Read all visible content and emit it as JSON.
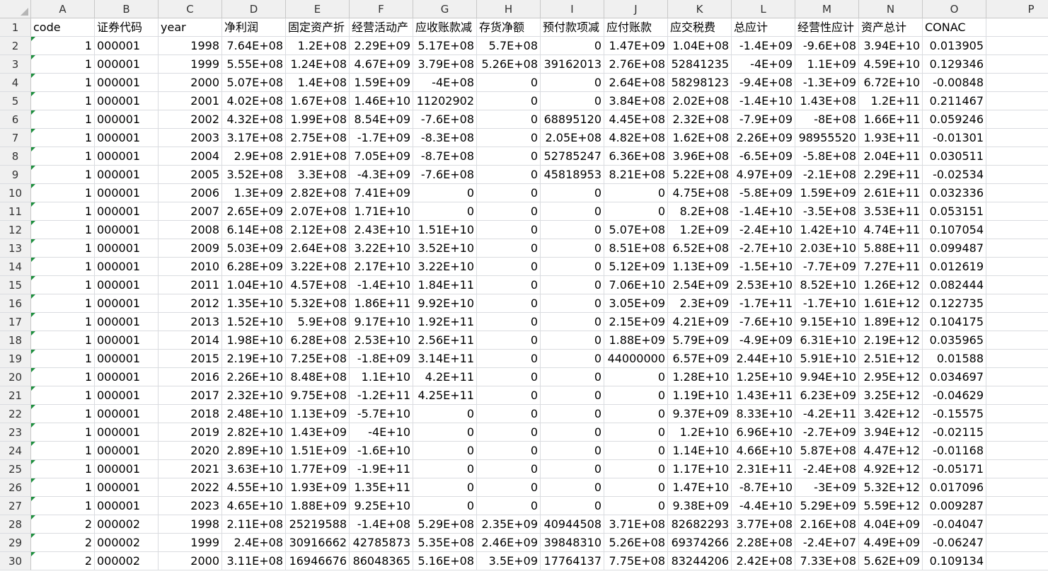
{
  "columns": [
    "A",
    "B",
    "C",
    "D",
    "E",
    "F",
    "G",
    "H",
    "I",
    "J",
    "K",
    "L",
    "M",
    "N",
    "O",
    "P"
  ],
  "header_row": {
    "num": "1",
    "cells": [
      "code",
      "证券代码",
      "year",
      "净利润",
      "固定资产折",
      "经营活动产",
      "应收账款减",
      "存货净额",
      "预付款项减",
      "应付账款",
      "应交税费",
      "总应计",
      "经营性应计",
      "资产总计",
      "CONAC",
      ""
    ]
  },
  "rows": [
    {
      "num": "2",
      "cells": [
        "1",
        "000001",
        "1998",
        "7.64E+08",
        "1.2E+08",
        "2.29E+09",
        "5.17E+08",
        "5.7E+08",
        "0",
        "1.47E+09",
        "1.04E+08",
        "-1.4E+09",
        "-9.6E+08",
        "3.94E+10",
        "0.013905"
      ]
    },
    {
      "num": "3",
      "cells": [
        "1",
        "000001",
        "1999",
        "5.55E+08",
        "1.24E+08",
        "4.67E+09",
        "3.79E+08",
        "5.26E+08",
        "39162013",
        "2.76E+08",
        "52841235",
        "-4E+09",
        "1.1E+09",
        "4.59E+10",
        "0.129346"
      ]
    },
    {
      "num": "4",
      "cells": [
        "1",
        "000001",
        "2000",
        "5.07E+08",
        "1.4E+08",
        "1.59E+09",
        "-4E+08",
        "0",
        "0",
        "2.64E+08",
        "58298123",
        "-9.4E+08",
        "-1.3E+09",
        "6.72E+10",
        "-0.00848"
      ]
    },
    {
      "num": "5",
      "cells": [
        "1",
        "000001",
        "2001",
        "4.02E+08",
        "1.67E+08",
        "1.46E+10",
        "11202902",
        "0",
        "0",
        "3.84E+08",
        "2.02E+08",
        "-1.4E+10",
        "1.43E+08",
        "1.2E+11",
        "0.211467"
      ]
    },
    {
      "num": "6",
      "cells": [
        "1",
        "000001",
        "2002",
        "4.32E+08",
        "1.99E+08",
        "8.54E+09",
        "-7.6E+08",
        "0",
        "68895120",
        "4.45E+08",
        "2.32E+08",
        "-7.9E+09",
        "-8E+08",
        "1.66E+11",
        "0.059246"
      ]
    },
    {
      "num": "7",
      "cells": [
        "1",
        "000001",
        "2003",
        "3.17E+08",
        "2.75E+08",
        "-1.7E+09",
        "-8.3E+08",
        "0",
        "2.05E+08",
        "4.82E+08",
        "1.62E+08",
        "2.26E+09",
        "98955520",
        "1.93E+11",
        "-0.01301"
      ]
    },
    {
      "num": "8",
      "cells": [
        "1",
        "000001",
        "2004",
        "2.9E+08",
        "2.91E+08",
        "7.05E+09",
        "-8.7E+08",
        "0",
        "52785247",
        "6.36E+08",
        "3.96E+08",
        "-6.5E+09",
        "-5.8E+08",
        "2.04E+11",
        "0.030511"
      ]
    },
    {
      "num": "9",
      "cells": [
        "1",
        "000001",
        "2005",
        "3.52E+08",
        "3.3E+08",
        "-4.3E+09",
        "-7.6E+08",
        "0",
        "45818953",
        "8.21E+08",
        "5.22E+08",
        "4.97E+09",
        "-2.1E+08",
        "2.29E+11",
        "-0.02534"
      ]
    },
    {
      "num": "10",
      "cells": [
        "1",
        "000001",
        "2006",
        "1.3E+09",
        "2.82E+08",
        "7.41E+09",
        "0",
        "0",
        "0",
        "0",
        "4.75E+08",
        "-5.8E+09",
        "1.59E+09",
        "2.61E+11",
        "0.032336"
      ]
    },
    {
      "num": "11",
      "cells": [
        "1",
        "000001",
        "2007",
        "2.65E+09",
        "2.07E+08",
        "1.71E+10",
        "0",
        "0",
        "0",
        "0",
        "8.2E+08",
        "-1.4E+10",
        "-3.5E+08",
        "3.53E+11",
        "0.053151"
      ]
    },
    {
      "num": "12",
      "cells": [
        "1",
        "000001",
        "2008",
        "6.14E+08",
        "2.12E+08",
        "2.43E+10",
        "1.51E+10",
        "0",
        "0",
        "5.07E+08",
        "1.2E+09",
        "-2.4E+10",
        "1.42E+10",
        "4.74E+11",
        "0.107054"
      ]
    },
    {
      "num": "13",
      "cells": [
        "1",
        "000001",
        "2009",
        "5.03E+09",
        "2.64E+08",
        "3.22E+10",
        "3.52E+10",
        "0",
        "0",
        "8.51E+08",
        "6.52E+08",
        "-2.7E+10",
        "2.03E+10",
        "5.88E+11",
        "0.099487"
      ]
    },
    {
      "num": "14",
      "cells": [
        "1",
        "000001",
        "2010",
        "6.28E+09",
        "3.22E+08",
        "2.17E+10",
        "3.22E+10",
        "0",
        "0",
        "5.12E+09",
        "1.13E+09",
        "-1.5E+10",
        "-7.7E+09",
        "7.27E+11",
        "0.012619"
      ]
    },
    {
      "num": "15",
      "cells": [
        "1",
        "000001",
        "2011",
        "1.04E+10",
        "4.57E+08",
        "-1.4E+10",
        "1.84E+11",
        "0",
        "0",
        "7.06E+10",
        "2.54E+09",
        "2.53E+10",
        "8.52E+10",
        "1.26E+12",
        "0.082444"
      ]
    },
    {
      "num": "16",
      "cells": [
        "1",
        "000001",
        "2012",
        "1.35E+10",
        "5.32E+08",
        "1.86E+11",
        "9.92E+10",
        "0",
        "0",
        "3.05E+09",
        "2.3E+09",
        "-1.7E+11",
        "-1.7E+10",
        "1.61E+12",
        "0.122735"
      ]
    },
    {
      "num": "17",
      "cells": [
        "1",
        "000001",
        "2013",
        "1.52E+10",
        "5.9E+08",
        "9.17E+10",
        "1.92E+11",
        "0",
        "0",
        "2.15E+09",
        "4.21E+09",
        "-7.6E+10",
        "9.15E+10",
        "1.89E+12",
        "0.104175"
      ]
    },
    {
      "num": "18",
      "cells": [
        "1",
        "000001",
        "2014",
        "1.98E+10",
        "6.28E+08",
        "2.53E+10",
        "2.56E+11",
        "0",
        "0",
        "1.88E+09",
        "5.79E+09",
        "-4.9E+09",
        "6.31E+10",
        "2.19E+12",
        "0.035965"
      ]
    },
    {
      "num": "19",
      "cells": [
        "1",
        "000001",
        "2015",
        "2.19E+10",
        "7.25E+08",
        "-1.8E+09",
        "3.14E+11",
        "0",
        "0",
        "44000000",
        "6.57E+09",
        "2.44E+10",
        "5.91E+10",
        "2.51E+12",
        "0.01588"
      ]
    },
    {
      "num": "20",
      "cells": [
        "1",
        "000001",
        "2016",
        "2.26E+10",
        "8.48E+08",
        "1.1E+10",
        "4.2E+11",
        "0",
        "0",
        "0",
        "1.28E+10",
        "1.25E+10",
        "9.94E+10",
        "2.95E+12",
        "0.034697"
      ]
    },
    {
      "num": "21",
      "cells": [
        "1",
        "000001",
        "2017",
        "2.32E+10",
        "9.75E+08",
        "-1.2E+11",
        "4.25E+11",
        "0",
        "0",
        "0",
        "1.19E+10",
        "1.43E+11",
        "6.23E+09",
        "3.25E+12",
        "-0.04629"
      ]
    },
    {
      "num": "22",
      "cells": [
        "1",
        "000001",
        "2018",
        "2.48E+10",
        "1.13E+09",
        "-5.7E+10",
        "0",
        "0",
        "0",
        "0",
        "9.37E+09",
        "8.33E+10",
        "-4.2E+11",
        "3.42E+12",
        "-0.15575"
      ]
    },
    {
      "num": "23",
      "cells": [
        "1",
        "000001",
        "2019",
        "2.82E+10",
        "1.43E+09",
        "-4E+10",
        "0",
        "0",
        "0",
        "0",
        "1.2E+10",
        "6.96E+10",
        "-2.7E+09",
        "3.94E+12",
        "-0.02115"
      ]
    },
    {
      "num": "24",
      "cells": [
        "1",
        "000001",
        "2020",
        "2.89E+10",
        "1.51E+09",
        "-1.6E+10",
        "0",
        "0",
        "0",
        "0",
        "1.14E+10",
        "4.66E+10",
        "5.87E+08",
        "4.47E+12",
        "-0.01168"
      ]
    },
    {
      "num": "25",
      "cells": [
        "1",
        "000001",
        "2021",
        "3.63E+10",
        "1.77E+09",
        "-1.9E+11",
        "0",
        "0",
        "0",
        "0",
        "1.17E+10",
        "2.31E+11",
        "-2.4E+08",
        "4.92E+12",
        "-0.05171"
      ]
    },
    {
      "num": "26",
      "cells": [
        "1",
        "000001",
        "2022",
        "4.55E+10",
        "1.93E+09",
        "1.35E+11",
        "0",
        "0",
        "0",
        "0",
        "1.47E+10",
        "-8.7E+10",
        "-3E+09",
        "5.32E+12",
        "0.017096"
      ]
    },
    {
      "num": "27",
      "cells": [
        "1",
        "000001",
        "2023",
        "4.65E+10",
        "1.88E+09",
        "9.25E+10",
        "0",
        "0",
        "0",
        "0",
        "9.38E+09",
        "-4.4E+10",
        "5.29E+09",
        "5.59E+12",
        "0.009287"
      ]
    },
    {
      "num": "28",
      "cells": [
        "2",
        "000002",
        "1998",
        "2.11E+08",
        "25219588",
        "-1.4E+08",
        "5.29E+08",
        "2.35E+09",
        "40944508",
        "3.71E+08",
        "82682293",
        "3.77E+08",
        "2.16E+08",
        "4.04E+09",
        "-0.04047"
      ]
    },
    {
      "num": "29",
      "cells": [
        "2",
        "000002",
        "1999",
        "2.4E+08",
        "30916662",
        "42785873",
        "5.35E+08",
        "2.46E+09",
        "39848310",
        "5.26E+08",
        "69374266",
        "2.28E+08",
        "-2.4E+07",
        "4.49E+09",
        "-0.06247"
      ]
    },
    {
      "num": "30",
      "cells": [
        "2",
        "000002",
        "2000",
        "3.11E+08",
        "16946676",
        "86048365",
        "5.16E+08",
        "3.5E+09",
        "17764137",
        "7.75E+08",
        "83244206",
        "2.42E+08",
        "7.33E+08",
        "5.62E+09",
        "0.109134"
      ]
    }
  ]
}
